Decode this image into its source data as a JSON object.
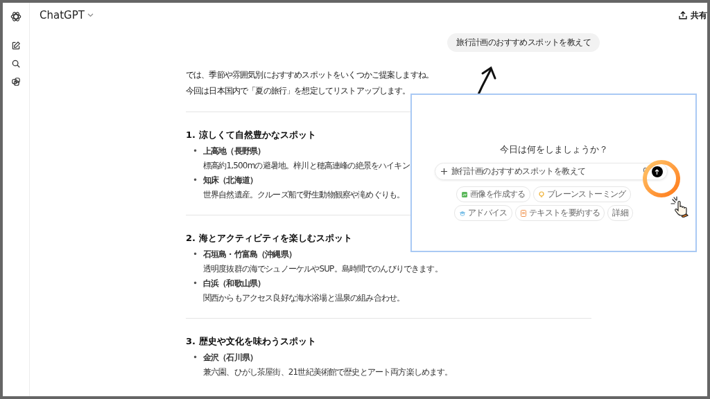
{
  "header": {
    "title": "ChatGPT",
    "share": "共有"
  },
  "user_message": "旅行計画のおすすめスポットを教えて",
  "reply": {
    "bullet": "•",
    "intro": [
      "では、季節や雰囲気別におすすめスポットをいくつかご提案しますね。",
      "今回は日本国内で「夏の旅行」を想定してリストアップします。"
    ],
    "sections": [
      {
        "heading": "1. 涼しくて自然豊かなスポット",
        "items": [
          {
            "name": "上高地（長野県）",
            "description": "標高約1,500mの避暑地。梓川と穂高連峰の絶景をハイキン"
          },
          {
            "name": "知床（北海道）",
            "description": "世界自然遺産。クルーズ船で野生動物観察や滝めぐりも。"
          }
        ]
      },
      {
        "heading": "2. 海とアクティビティを楽しむスポット",
        "items": [
          {
            "name": "石垣島・竹富島（沖縄県）",
            "description": "透明度抜群の海でシュノーケルやSUP。島時間でのんびりできます。"
          },
          {
            "name": "白浜（和歌山県）",
            "description": "関西からもアクセス良好な海水浴場と温泉の組み合わせ。"
          }
        ]
      },
      {
        "heading": "3. 歴史や文化を味わうスポット",
        "items": [
          {
            "name": "金沢（石川県）",
            "description": "兼六園、ひがし茶屋街、21世紀美術館で歴史とアート両方楽しめます。"
          }
        ]
      }
    ]
  },
  "inset": {
    "greeting": "今日は何をしましょうか？",
    "input_value": "旅行計画のおすすめスポットを教えて",
    "suggestions": [
      {
        "kind": "image",
        "label": "画像を作成する"
      },
      {
        "kind": "idea",
        "label": "ブレーンストーミング"
      },
      {
        "kind": "advice",
        "label": "アドバイス"
      },
      {
        "kind": "summary",
        "label": "テキストを要約する"
      },
      {
        "kind": "more",
        "label": "詳細"
      }
    ]
  }
}
